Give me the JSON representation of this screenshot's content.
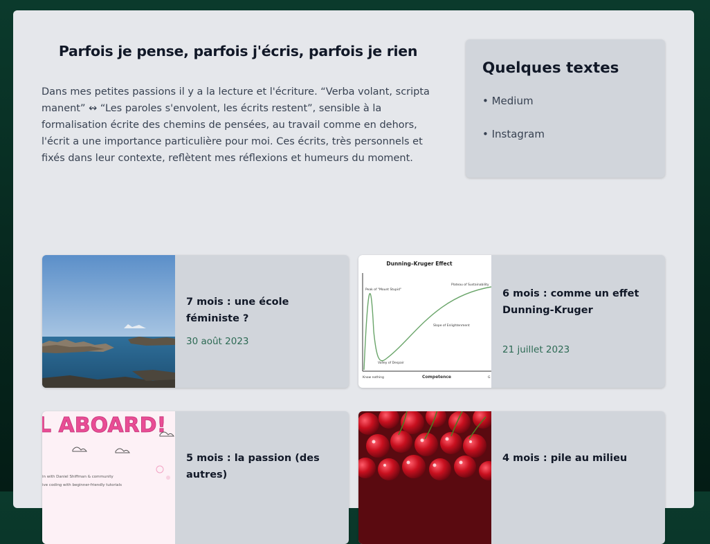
{
  "intro": {
    "title": "Parfois je pense, parfois j'écris, parfois je rien",
    "text": "Dans mes petites passions il y a la lecture et l'écriture. “Verba volant, scripta manent” ↭ “Les paroles s'envolent, les écrits restent”, sensible à la formalisation écrite des chemins de pensées, au travail comme en dehors, l'écrit a une importance particulière pour moi. Ces écrits, très personnels et fixés dans leur contexte, reflètent mes réflexions et humeurs du moment."
  },
  "aside": {
    "title": "Quelques textes",
    "links": [
      "• Medium",
      "• Instagram"
    ]
  },
  "articles": [
    {
      "title": "7 mois : une école féministe ?",
      "date": "30 août 2023",
      "thumb": "seaside-photo"
    },
    {
      "title": "6 mois : comme un effet Dunning-Kruger",
      "date": "21 juillet 2023",
      "thumb": "dunning-kruger-chart"
    },
    {
      "title": "5 mois : la passion (des autres)",
      "date": "",
      "thumb": "all-aboard-poster"
    },
    {
      "title": "4 mois : pile au milieu",
      "date": "",
      "thumb": "cherries-photo"
    }
  ],
  "thumbs": {
    "dunning_kruger": {
      "title": "Dunning–Kruger Effect",
      "peak": "Peak of \"Mount Stupid\"",
      "plateau": "Plateau of Sustainability",
      "slope": "Slope of Enlightenment",
      "valley": "Valley of Despair",
      "x_start": "Know nothing",
      "x_label": "Competence",
      "x_end": "G"
    },
    "poster": {
      "headline": "L ABOARD!",
      "line1": "in with Daniel Shiffman & community",
      "line2": "ive coding with beginner-friendly tutorials"
    }
  },
  "colors": {
    "background": "#0b3a2c",
    "panel": "#e5e7eb",
    "card": "#d1d5db",
    "date": "#2d6a54"
  }
}
